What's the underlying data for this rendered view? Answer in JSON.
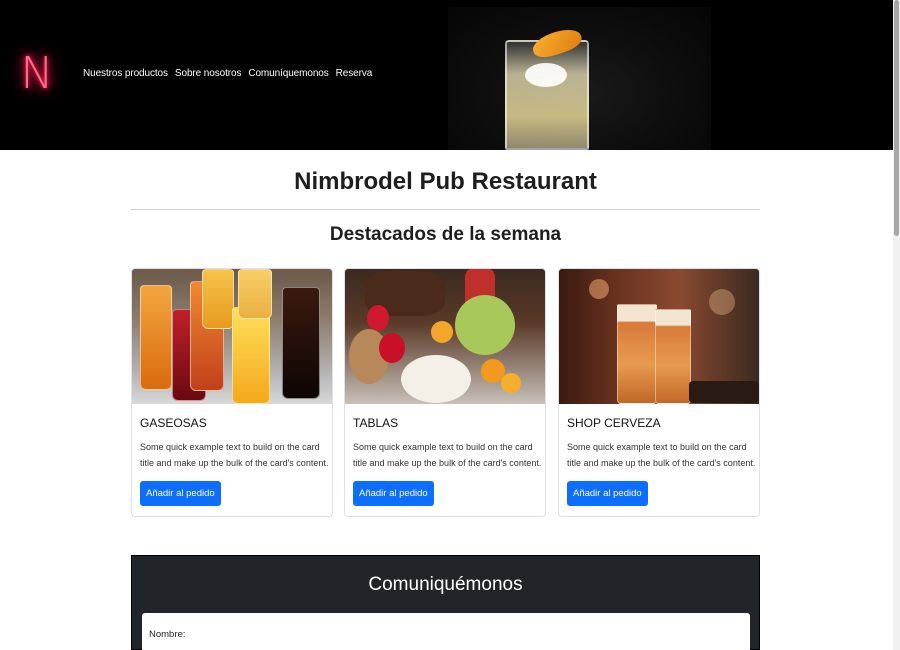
{
  "header": {
    "logo_letter": "N",
    "nav": [
      "Nuestros productos",
      "Sobre nosotros",
      "Comuníquemonos",
      "Reserva"
    ]
  },
  "main": {
    "title": "Nimbrodel Pub Restaurant",
    "section_title": "Destacados de la semana"
  },
  "cards": [
    {
      "title": "GASEOSAS",
      "text": "Some quick example text to build on the card title and make up the bulk of the card's content.",
      "button": "Añadir al pedido",
      "image": "colorful-drinks-photo"
    },
    {
      "title": "TABLAS",
      "text": "Some quick example text to build on the card title and make up the bulk of the card's content.",
      "button": "Añadir al pedido",
      "image": "cheese-fruit-platter-photo"
    },
    {
      "title": "SHOP CERVEZA",
      "text": "Some quick example text to build on the card title and make up the bulk of the card's content.",
      "button": "Añadir al pedido",
      "image": "beer-glasses-photo"
    }
  ],
  "contact": {
    "title": "Comuniquémonos",
    "name_label": "Nombre:"
  },
  "colors": {
    "header_bg": "#000000",
    "button": "#0d6efd",
    "contact_bg": "#212529",
    "logo_neon": "#ff2255"
  }
}
